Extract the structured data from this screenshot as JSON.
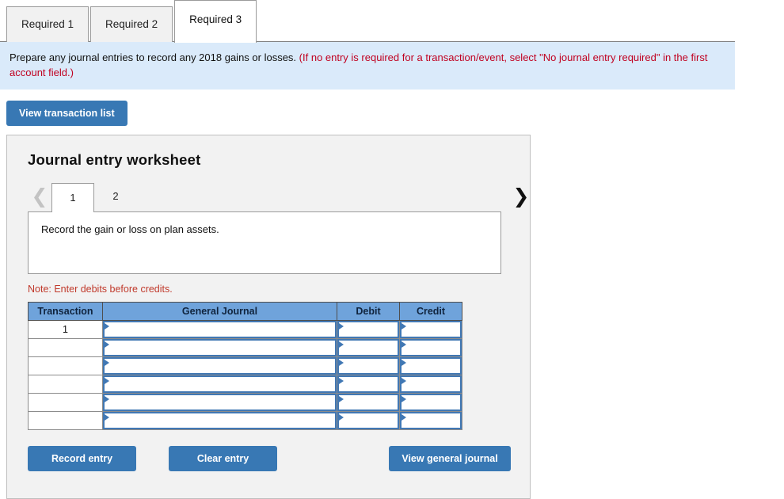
{
  "tabs": [
    {
      "label": "Required 1",
      "active": false
    },
    {
      "label": "Required 2",
      "active": false
    },
    {
      "label": "Required 3",
      "active": true
    }
  ],
  "banner": {
    "text": "Prepare any journal entries to record any 2018 gains or losses.",
    "hint": "(If no entry is required for a transaction/event, select \"No journal entry required\" in the first account field.)"
  },
  "toolbar": {
    "view_transaction_list_label": "View transaction list"
  },
  "worksheet": {
    "title": "Journal entry worksheet",
    "prev_icon": "chevron-left-icon",
    "next_icon": "chevron-right-icon",
    "pages": [
      {
        "label": "1",
        "active": true
      },
      {
        "label": "2",
        "active": false
      }
    ],
    "description": "Record the gain or loss on plan assets.",
    "note": "Note: Enter debits before credits.",
    "table": {
      "headers": [
        "Transaction",
        "General Journal",
        "Debit",
        "Credit"
      ],
      "rows": [
        {
          "transaction": "1",
          "general_journal": "",
          "debit": "",
          "credit": ""
        },
        {
          "transaction": "",
          "general_journal": "",
          "debit": "",
          "credit": ""
        },
        {
          "transaction": "",
          "general_journal": "",
          "debit": "",
          "credit": ""
        },
        {
          "transaction": "",
          "general_journal": "",
          "debit": "",
          "credit": ""
        },
        {
          "transaction": "",
          "general_journal": "",
          "debit": "",
          "credit": ""
        },
        {
          "transaction": "",
          "general_journal": "",
          "debit": "",
          "credit": ""
        }
      ]
    },
    "buttons": {
      "record_entry": "Record entry",
      "clear_entry": "Clear entry",
      "view_general_journal": "View general journal"
    }
  },
  "colors": {
    "button_blue": "#3878b4",
    "banner_blue": "#daeafa",
    "header_blue": "#6fa3db",
    "field_border": "#4178b4",
    "note_red": "#c0392b",
    "panel_gray": "#f2f2f2"
  }
}
